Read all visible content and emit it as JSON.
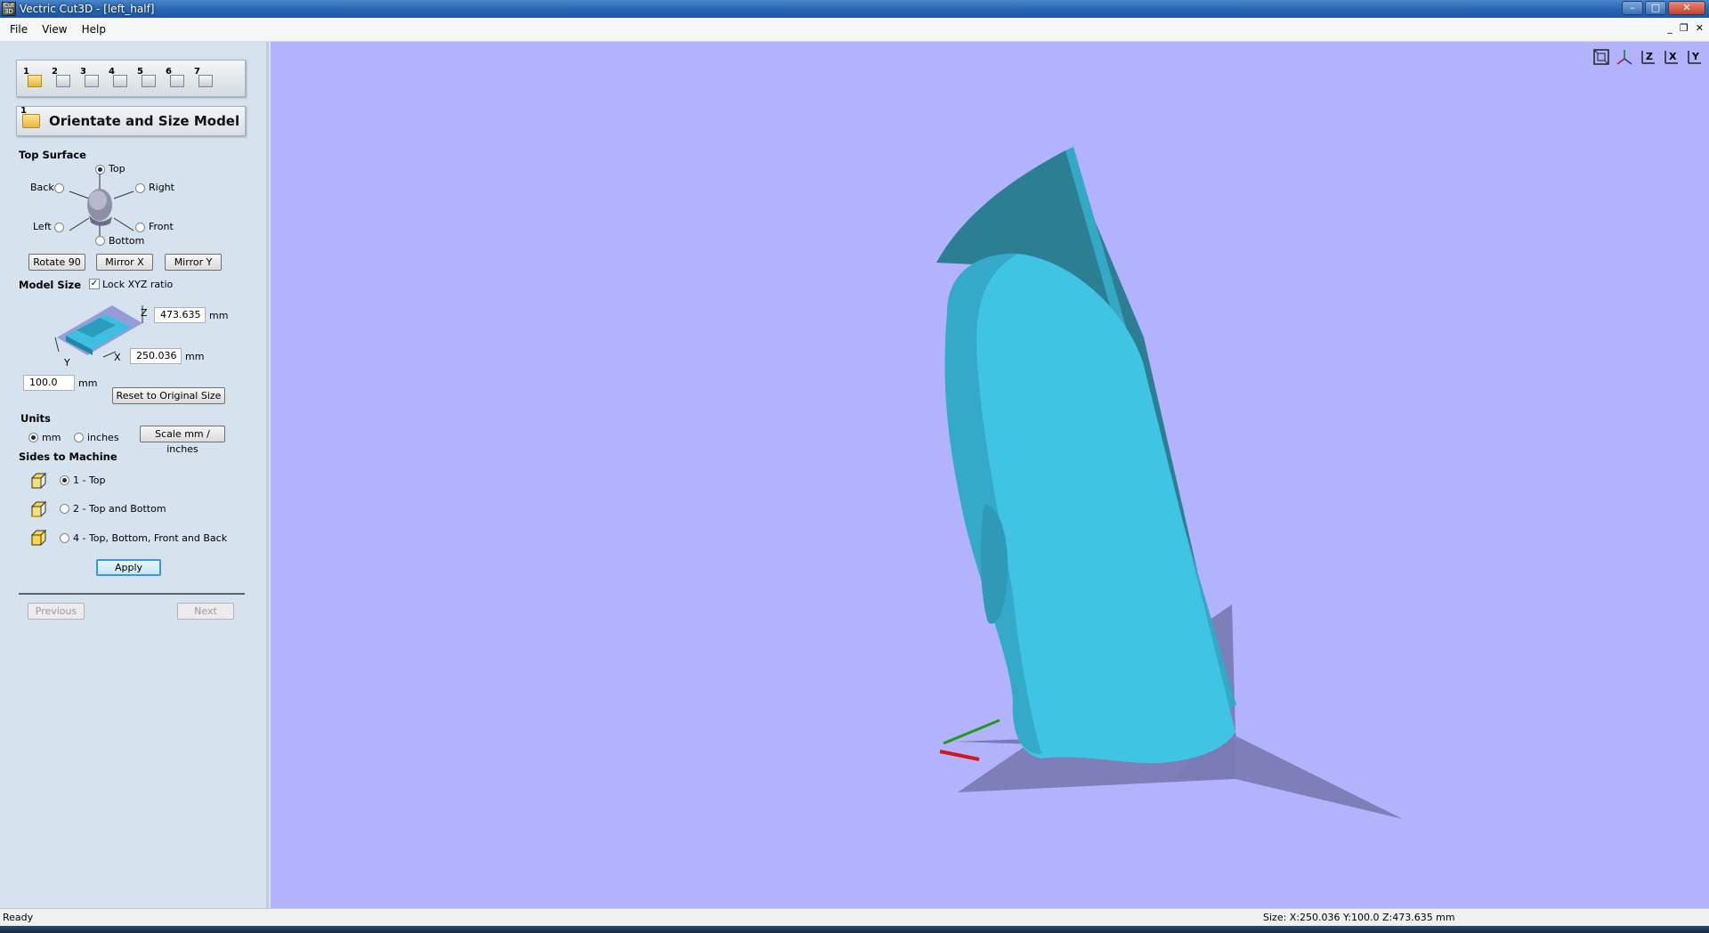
{
  "window": {
    "title": "Vectric Cut3D - [left_half]",
    "app_icon_text": "Cut 3D"
  },
  "menu": {
    "items": [
      "File",
      "View",
      "Help"
    ]
  },
  "wizard": {
    "steps": [
      "1",
      "2",
      "3",
      "4",
      "5",
      "6",
      "7"
    ],
    "current_step_title": "Orientate and Size Model"
  },
  "top_surface": {
    "label": "Top Surface",
    "options": {
      "top": "Top",
      "back": "Back",
      "right": "Right",
      "left": "Left",
      "front": "Front",
      "bottom": "Bottom"
    },
    "selected": "Top",
    "buttons": {
      "rotate": "Rotate 90",
      "mirror_x": "Mirror X",
      "mirror_y": "Mirror Y"
    }
  },
  "model_size": {
    "label": "Model Size",
    "lock_label": "Lock XYZ ratio",
    "lock_checked": true,
    "z_value": "473.635",
    "x_value": "250.036",
    "y_value": "100.0",
    "unit": "mm",
    "axis_z": "Z",
    "axis_x": "X",
    "axis_y": "Y",
    "reset_label": "Reset to Original Size"
  },
  "units": {
    "label": "Units",
    "mm": "mm",
    "inches": "inches",
    "selected": "mm",
    "scale_label": "Scale mm / inches"
  },
  "sides": {
    "label": "Sides to Machine",
    "options": [
      "1 - Top",
      "2 - Top and Bottom",
      "4 - Top, Bottom, Front and Back"
    ],
    "selected": 0,
    "apply_label": "Apply"
  },
  "nav": {
    "previous": "Previous",
    "next": "Next"
  },
  "view_icons": [
    "zoom-extents-icon",
    "iso-view-icon",
    "view-z-icon",
    "view-x-icon",
    "view-y-icon"
  ],
  "view_axis_labels": {
    "z": "Z",
    "x": "X",
    "y": "Y"
  },
  "status": {
    "left": "Ready",
    "right": "Size: X:250.036 Y:100.0 Z:473.635 mm"
  },
  "colors": {
    "viewport_bg": "#b3b2fc",
    "model": "#3fbfe0",
    "panel_bg": "#d6e2ee"
  }
}
